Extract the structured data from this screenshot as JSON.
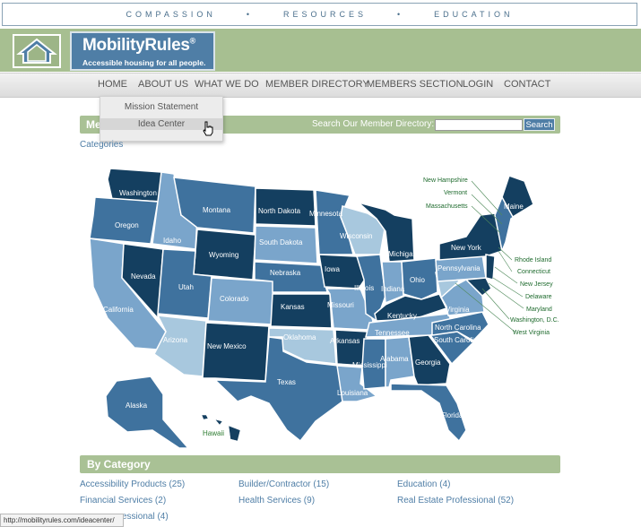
{
  "tagline": [
    "COMPASSION",
    "•",
    "RESOURCES",
    "•",
    "EDUCATION"
  ],
  "brand": {
    "name": "MobilityRules",
    "reg": "®",
    "tagline": "Accessible housing for all people."
  },
  "nav": [
    "HOME",
    "ABOUT US",
    "WHAT WE DO",
    "MEMBER DIRECTORY",
    "MEMBERS SECTION",
    "LOGIN",
    "CONTACT"
  ],
  "dropdown": [
    "Mission Statement",
    "Idea Center"
  ],
  "search_bar": {
    "title": "Me",
    "label": "Search Our Member Directory:",
    "button": "Search",
    "value": ""
  },
  "categories_link": "Categories",
  "map_labels": {
    "west": [
      "Washington",
      "Oregon",
      "California",
      "Nevada",
      "Idaho",
      "Montana",
      "Wyoming",
      "Utah",
      "Arizona",
      "Colorado",
      "New Mexico",
      "Alaska",
      "Hawaii"
    ],
    "central": [
      "North Dakota",
      "South Dakota",
      "Nebraska",
      "Kansas",
      "Oklahoma",
      "Texas",
      "Minnesota",
      "Iowa",
      "Missouri",
      "Arkansas",
      "Louisiana",
      "Wisconsin",
      "Illinois",
      "Michigan",
      "Indiana"
    ],
    "east": [
      "Ohio",
      "Kentucky",
      "Tennessee",
      "Mississippi",
      "Alabama",
      "Georgia",
      "Florida",
      "South Carolina",
      "North Carolina",
      "Virginia",
      "Pennsylvania",
      "New York",
      "Maine"
    ],
    "callouts": [
      "New Hampshire",
      "Vermont",
      "Massachusetts",
      "Rhode Island",
      "Connecticut",
      "New Jersey",
      "Delaware",
      "Maryland",
      "Washington, D.C.",
      "West Virginia"
    ]
  },
  "by_category": {
    "title": "By Category",
    "items": [
      "Accessibility Products (25)",
      "Builder/Contractor (15)",
      "Education (4)",
      "Financial Services (2)",
      "Health Services (9)",
      "Real Estate Professional (52)",
      "essional (4)"
    ]
  },
  "status_url": "http://mobilityrules.com/ideacenter/",
  "colors": {
    "green": "#a9c195",
    "blue": "#4f7ea6",
    "navy": "#143f60",
    "light": "#7aa5cb"
  }
}
